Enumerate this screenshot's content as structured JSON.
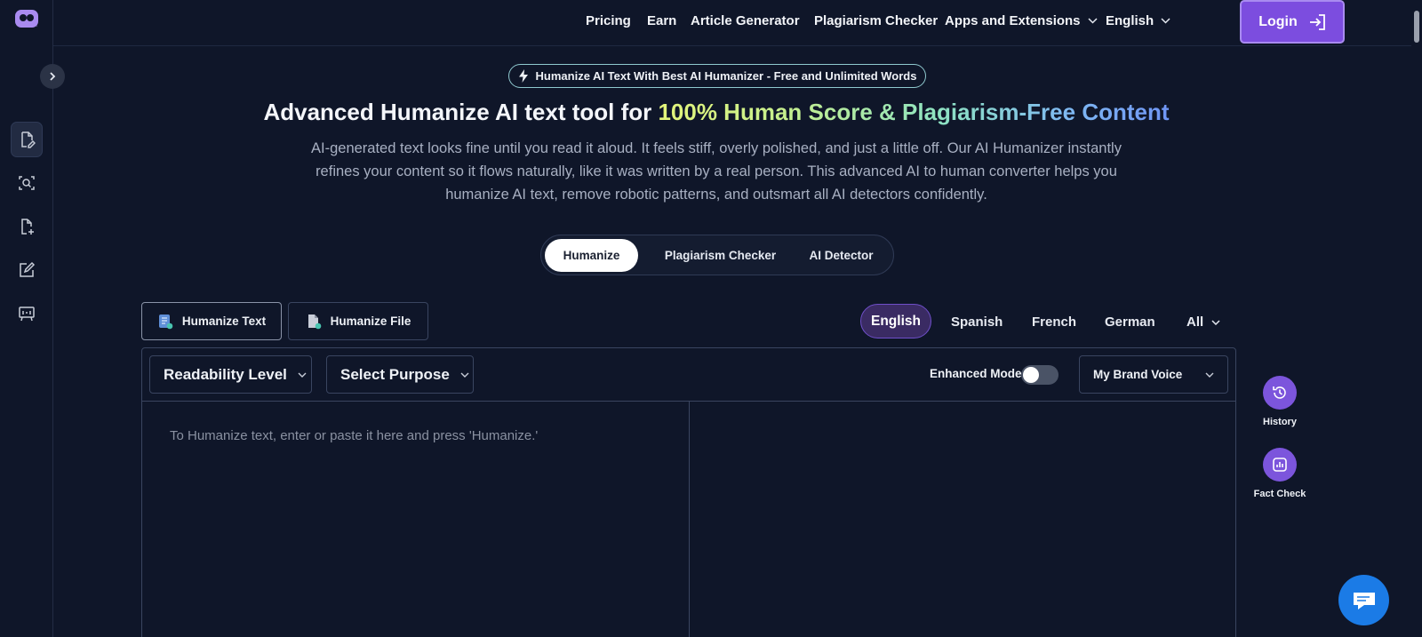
{
  "nav": {
    "pricing": "Pricing",
    "earn": "Earn",
    "article_generator": "Article Generator",
    "plagiarism_checker": "Plagiarism Checker",
    "apps_extensions": "Apps and Extensions",
    "language": "English",
    "login": "Login"
  },
  "hero": {
    "badge": "Humanize AI Text With Best AI Humanizer - Free and Unlimited Words",
    "title_plain": "Advanced Humanize AI text tool for ",
    "title_highlight": "100% Human Score & Plagiarism-Free Content",
    "description": "AI-generated text looks fine until you read it aloud. It feels stiff, overly polished, and just a little off. Our AI Humanizer instantly refines your content so it flows naturally, like it was written by a real person. This advanced AI to human converter helps you humanize AI text, remove robotic patterns, and outsmart all AI detectors confidently."
  },
  "tool_tabs": [
    {
      "label": "Humanize",
      "active": true
    },
    {
      "label": "Plagiarism Checker",
      "active": false
    },
    {
      "label": "AI Detector",
      "active": false
    }
  ],
  "mode_tabs": [
    {
      "label": "Humanize Text",
      "active": true,
      "icon": "document-text-icon"
    },
    {
      "label": "Humanize File",
      "active": false,
      "icon": "file-upload-icon"
    }
  ],
  "languages": {
    "selected": "English",
    "others": [
      "Spanish",
      "French",
      "German"
    ],
    "all": "All"
  },
  "toolbar": {
    "readability": "Readability Level",
    "purpose": "Select Purpose",
    "enhanced_mode": "Enhanced Mode",
    "enhanced_mode_on": false,
    "brand_voice": "My Brand Voice"
  },
  "editor": {
    "placeholder": "To Humanize text, enter or paste it here and press 'Humanize.'"
  },
  "side_tools": {
    "history": "History",
    "fact_check": "Fact Check"
  },
  "colors": {
    "background": "#0f1629",
    "accent": "#7c4ddf",
    "chat": "#1b7be6"
  }
}
